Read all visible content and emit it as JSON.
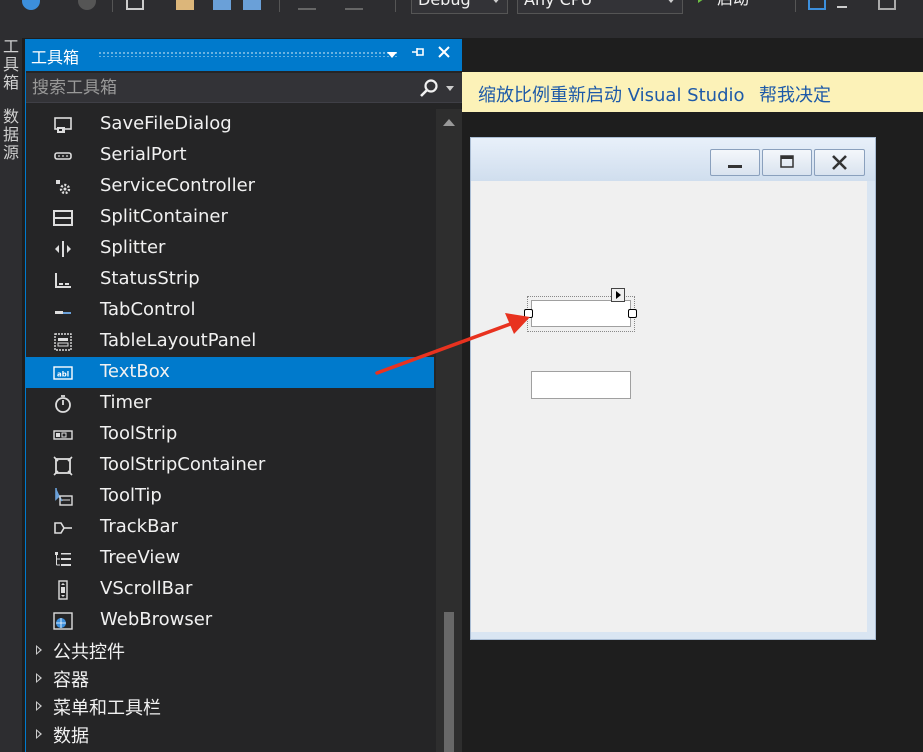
{
  "toolbar": {
    "config_value": "Debug",
    "platform_value": "Any CPU",
    "start_label": "启动"
  },
  "side_tabs": {
    "toolbox_tab": "工具箱",
    "datasource_tab": "数据源"
  },
  "toolbox": {
    "title": "工具箱",
    "search_placeholder": "搜索工具箱",
    "items": [
      {
        "label": "SaveFileDialog",
        "icon": "save-file-dialog-icon"
      },
      {
        "label": "SerialPort",
        "icon": "serial-port-icon"
      },
      {
        "label": "ServiceController",
        "icon": "gear-icon"
      },
      {
        "label": "SplitContainer",
        "icon": "split-container-icon"
      },
      {
        "label": "Splitter",
        "icon": "splitter-icon"
      },
      {
        "label": "StatusStrip",
        "icon": "status-strip-icon"
      },
      {
        "label": "TabControl",
        "icon": "tab-control-icon"
      },
      {
        "label": "TableLayoutPanel",
        "icon": "table-layout-icon"
      },
      {
        "label": "TextBox",
        "icon": "textbox-icon",
        "selected": true
      },
      {
        "label": "Timer",
        "icon": "timer-icon"
      },
      {
        "label": "ToolStrip",
        "icon": "toolstrip-icon"
      },
      {
        "label": "ToolStripContainer",
        "icon": "toolstrip-container-icon"
      },
      {
        "label": "ToolTip",
        "icon": "tooltip-icon"
      },
      {
        "label": "TrackBar",
        "icon": "trackbar-icon"
      },
      {
        "label": "TreeView",
        "icon": "treeview-icon"
      },
      {
        "label": "VScrollBar",
        "icon": "vscrollbar-icon"
      },
      {
        "label": "WebBrowser",
        "icon": "globe-icon"
      }
    ],
    "groups": [
      "公共控件",
      "容器",
      "菜单和工具栏",
      "数据"
    ]
  },
  "infobar": {
    "message": "缩放比例重新启动 Visual Studio",
    "action": "帮我决定"
  },
  "colors": {
    "accent": "#007acc",
    "annotation_arrow": "#e8321f",
    "infobar_bg": "#fcf2b8"
  }
}
